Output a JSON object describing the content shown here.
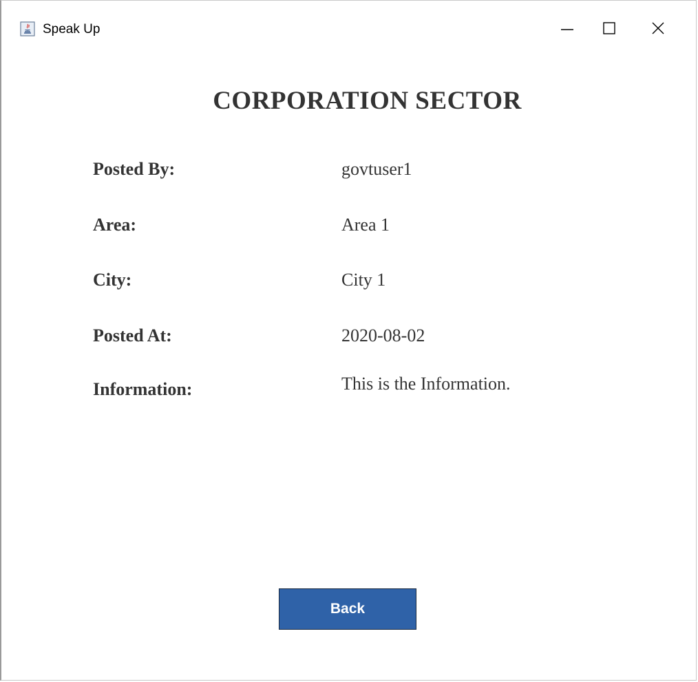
{
  "window": {
    "title": "Speak Up",
    "icon": "java-app-icon",
    "controls": [
      "minimize-icon",
      "maximize-icon",
      "close-icon"
    ]
  },
  "page": {
    "heading": "CORPORATION SECTOR"
  },
  "fields": [
    {
      "label": "Posted By:",
      "value": "govtuser1"
    },
    {
      "label": "Area:",
      "value": "Area 1"
    },
    {
      "label": "City:",
      "value": "City 1"
    },
    {
      "label": "Posted At:",
      "value": "2020-08-02"
    },
    {
      "label": "Information:",
      "value": "This is the Information."
    }
  ],
  "actions": {
    "back_label": "Back"
  },
  "colors": {
    "button_bg": "#2f62a8",
    "text": "#333333"
  }
}
